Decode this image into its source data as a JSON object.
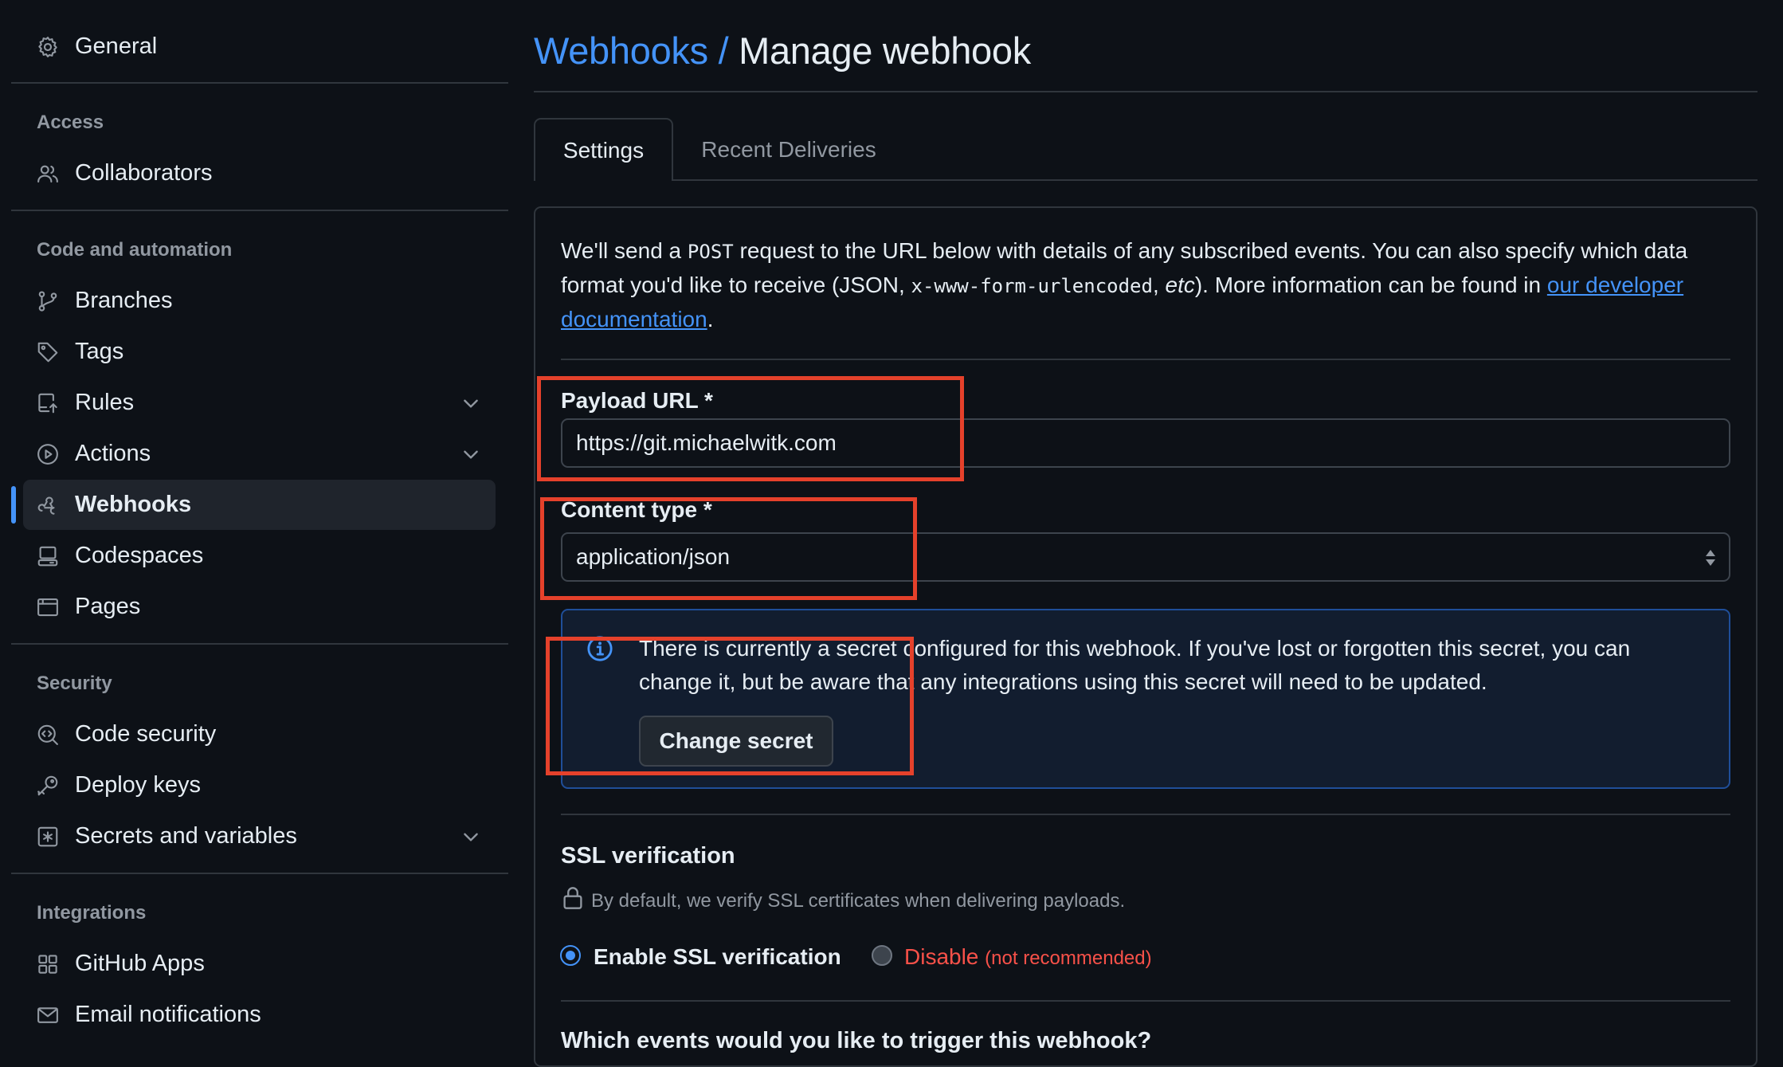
{
  "sidebar": {
    "general": "General",
    "sections": {
      "access": "Access",
      "code_automation": "Code and automation",
      "security": "Security",
      "integrations": "Integrations"
    },
    "items": {
      "collaborators": "Collaborators",
      "branches": "Branches",
      "tags": "Tags",
      "rules": "Rules",
      "actions": "Actions",
      "webhooks": "Webhooks",
      "codespaces": "Codespaces",
      "pages": "Pages",
      "code_security": "Code security",
      "deploy_keys": "Deploy keys",
      "secrets": "Secrets and variables",
      "github_apps": "GitHub Apps",
      "email_notifications": "Email notifications"
    },
    "active": "Webhooks"
  },
  "header": {
    "breadcrumb": "Webhooks /",
    "title": "Manage webhook"
  },
  "tabs": {
    "settings": "Settings",
    "recent": "Recent Deliveries"
  },
  "intro": {
    "p1": "We'll send a ",
    "code1": "POST",
    "p2": " request to the URL below with details of any subscribed events. You can also specify which data format you'd like to receive (JSON, ",
    "code2": "x-www-form-urlencoded",
    "p3": ", ",
    "etc": "etc",
    "p4": "). More information can be found in ",
    "link": "our developer documentation",
    "p5": "."
  },
  "payload": {
    "label": "Payload URL *",
    "value": "https://git.michaelwitk.com"
  },
  "content_type": {
    "label": "Content type *",
    "value": "application/json"
  },
  "secret": {
    "message": "There is currently a secret configured for this webhook. If you've lost or forgotten this secret, you can change it, but be aware that any integrations using this secret will need to be updated.",
    "button": "Change secret"
  },
  "ssl": {
    "title": "SSL verification",
    "description": "By default, we verify SSL certificates when delivering payloads.",
    "enable": "Enable SSL verification",
    "disable": "Disable",
    "disable_note": "(not recommended)",
    "selected": "enable"
  },
  "events_question": "Which events would you like to trigger this webhook?",
  "colors": {
    "background": "#0d1117",
    "accent": "#4493f8",
    "danger": "#f85149",
    "annotation": "#e5412b"
  }
}
